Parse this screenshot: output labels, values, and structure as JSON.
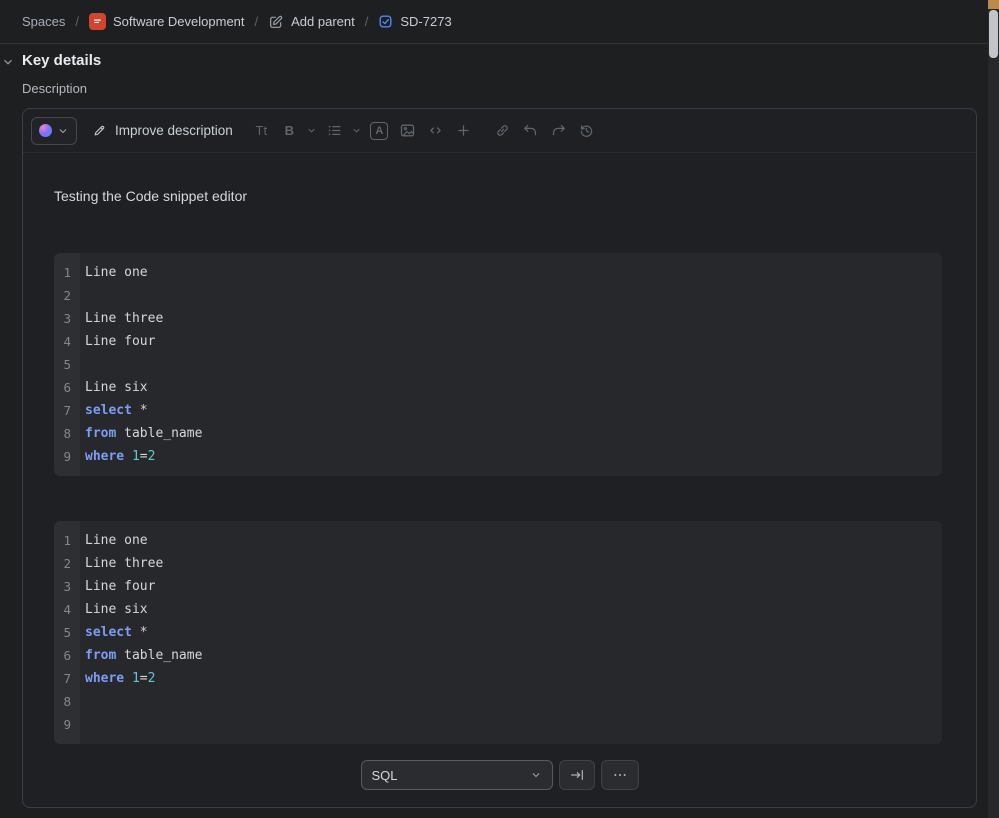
{
  "breadcrumb": {
    "separator": "/",
    "spaces_label": "Spaces",
    "space_name": "Software Development",
    "add_parent_label": "Add parent",
    "task_id": "SD-7273"
  },
  "key_details": {
    "title": "Key details",
    "description_label": "Description"
  },
  "toolbar": {
    "improve_description_label": "Improve description",
    "text_style_label": "Tt",
    "bold_label": "B",
    "text_color_label": "A"
  },
  "editor": {
    "intro_text": "Testing the Code snippet editor",
    "language_select_value": "SQL",
    "code_blocks": [
      {
        "lines": [
          [
            [
              "p",
              "Line one"
            ]
          ],
          [],
          [
            [
              "p",
              "Line three"
            ]
          ],
          [
            [
              "p",
              "Line four"
            ]
          ],
          [],
          [
            [
              "p",
              "Line six"
            ]
          ],
          [
            [
              "k",
              "select"
            ],
            [
              "p",
              " *"
            ]
          ],
          [
            [
              "k",
              "from"
            ],
            [
              "p",
              " table_name"
            ]
          ],
          [
            [
              "k",
              "where"
            ],
            [
              "p",
              " "
            ],
            [
              "n",
              "1"
            ],
            [
              "p",
              "="
            ],
            [
              "n",
              "2"
            ]
          ]
        ]
      },
      {
        "lines": [
          [
            [
              "p",
              "Line one"
            ]
          ],
          [
            [
              "p",
              "Line three"
            ]
          ],
          [
            [
              "p",
              "Line four"
            ]
          ],
          [
            [
              "p",
              "Line six"
            ]
          ],
          [
            [
              "k",
              "select"
            ],
            [
              "p",
              " *"
            ]
          ],
          [
            [
              "k",
              "from"
            ],
            [
              "p",
              " table_name"
            ]
          ],
          [
            [
              "k",
              "where"
            ],
            [
              "p",
              " "
            ],
            [
              "n",
              "1"
            ],
            [
              "p",
              "="
            ],
            [
              "n",
              "2"
            ]
          ],
          [],
          []
        ]
      }
    ]
  },
  "icons": {
    "space_avatar": "red-square",
    "add_parent": "pencil-square",
    "task_status": "blue-checkbox",
    "ai": "gradient-orb",
    "improve": "pen",
    "chevron_down": "⌄",
    "bullet_list": "list-bullets",
    "image": "image-frame",
    "code": "angle-brackets",
    "plus": "+",
    "link": "chain",
    "undo": "↶",
    "redo": "↷",
    "history": "clock-arrow",
    "wrap": "arrow-to-bar",
    "more": "⋯"
  },
  "colors": {
    "page_bg": "#1e1f21",
    "code_bg": "#26282b",
    "keyword": "#7e9cf5",
    "number": "#5fc6d8",
    "code_text": "#d4d7db",
    "accent_blue": "#4d8bf0",
    "space_icon_red": "#d1452f"
  }
}
